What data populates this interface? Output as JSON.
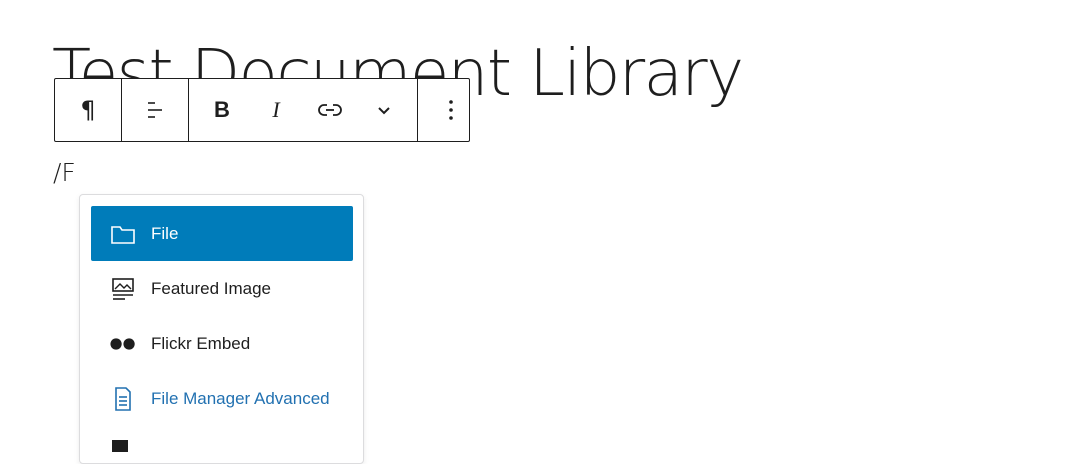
{
  "editor": {
    "title": "Test Document Library",
    "slash_command": "/F"
  },
  "toolbar": {
    "paragraph_glyph": "¶",
    "bold_label": "B",
    "italic_label": "I"
  },
  "inserter": {
    "items": [
      {
        "label": "File",
        "icon": "folder-icon",
        "state": "active"
      },
      {
        "label": "Featured Image",
        "icon": "featured-image-icon",
        "state": "normal"
      },
      {
        "label": "Flickr Embed",
        "icon": "flickr-icon",
        "state": "normal"
      },
      {
        "label": "File Manager Advanced",
        "icon": "document-icon",
        "state": "link"
      }
    ]
  },
  "colors": {
    "accent": "#007cba",
    "link": "#2271b1",
    "text": "#1e1e1e"
  }
}
